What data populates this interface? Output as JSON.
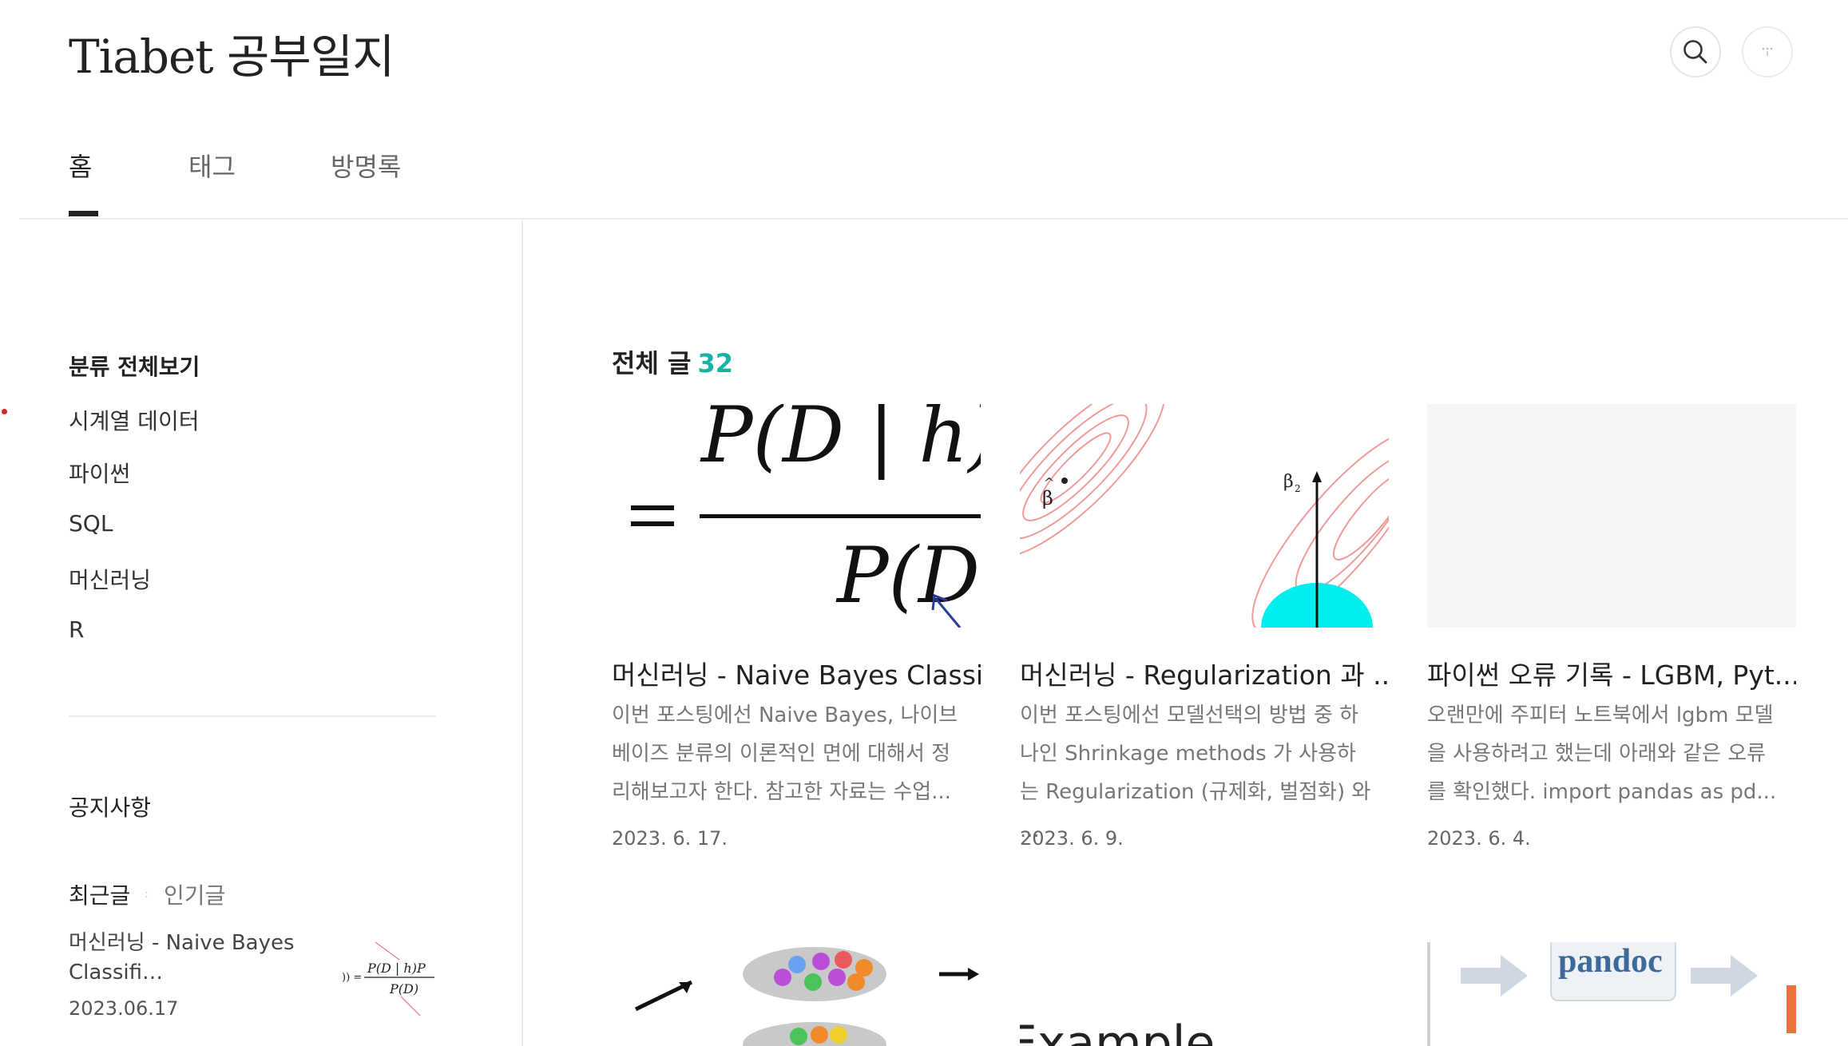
{
  "header": {
    "blog_title": "Tiabet 공부일지",
    "search_icon": "search-icon",
    "menu_icon": "more-menu-icon"
  },
  "nav": {
    "tabs": [
      {
        "label": "홈",
        "active": true
      },
      {
        "label": "태그",
        "active": false
      },
      {
        "label": "방명록",
        "active": false
      }
    ]
  },
  "sidebar": {
    "category_all": "분류 전체보기",
    "categories": [
      "시계열 데이터",
      "파이썬",
      "SQL",
      "머신러닝",
      "R"
    ],
    "notice_label": "공지사항",
    "tab_recent": "최근글",
    "tab_popular": "인기글",
    "recent_post": {
      "title": "머신러닝 - Naive Bayes Classifi…",
      "date": "2023.06.17"
    }
  },
  "main": {
    "heading": "전체 글",
    "count": "32",
    "accent_color": "#14b3a6",
    "posts": [
      {
        "title": "머신러닝 - Naive Bayes Classi...",
        "excerpt": "이번 포스팅에선 Naive Bayes, 나이브 베이즈 분류의 이론적인 면에 대해서 정리해보고자 한다. 참고한 자료는 수업...",
        "date": "2023. 6. 17."
      },
      {
        "title": "머신러닝 - Regularization 과 ...",
        "excerpt": "이번 포스팅에선 모델선택의 방법 중 하나인 Shrinkage methods 가 사용하는 Regularization (규제화, 벌점화) 와 ...",
        "date": "2023. 6. 9."
      },
      {
        "title": "파이썬 오류 기록 - LGBM, Pyt...",
        "excerpt": "오랜만에 주피터 노트북에서 lgbm 모델을 사용하려고 했는데 아래와 같은 오류를 확인했다. import pandas as pd...",
        "date": "2023. 6. 4."
      }
    ],
    "second_row_visible_text": {
      "example": "Example",
      "pandoc": "pandoc"
    }
  }
}
